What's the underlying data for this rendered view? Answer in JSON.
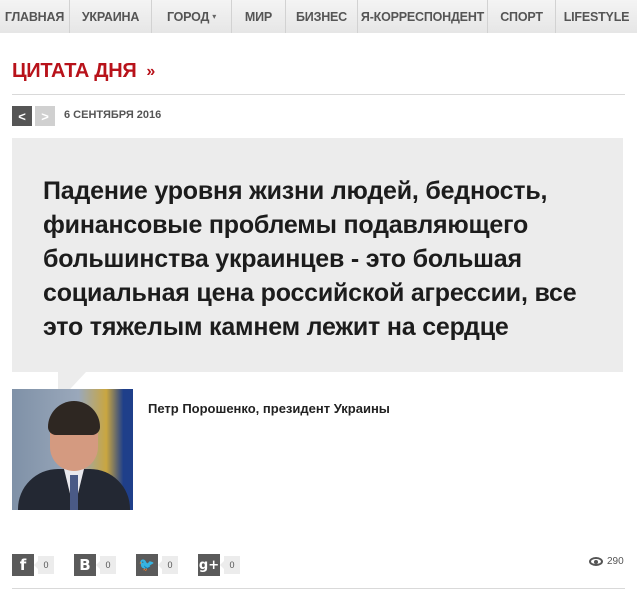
{
  "nav": {
    "items": [
      {
        "label": "ГЛАВНАЯ"
      },
      {
        "label": "УКРАИНА"
      },
      {
        "label": "ГОРОД",
        "caret": "▾"
      },
      {
        "label": "МИР"
      },
      {
        "label": "БИЗНЕС"
      },
      {
        "label": "Я-КОРРЕСПОНДЕНТ"
      },
      {
        "label": "СПОРТ"
      },
      {
        "label": "LIFESTYLE"
      }
    ]
  },
  "section": {
    "title": "ЦИТАТА ДНЯ",
    "arrow": "»"
  },
  "pager": {
    "prev": "<",
    "next": ">"
  },
  "date": "6 СЕНТЯБРЯ 2016",
  "quote": {
    "text": "Падение уровня жизни людей, бедность, финансовые проблемы подавляющего большинства украинцев - это большая социальная цена российской агрессии, все это тяжелым камнем лежит на сердце",
    "author": "Петр Порошенко, президент Украины"
  },
  "share": [
    {
      "network": "facebook",
      "glyph": "f",
      "count": "0"
    },
    {
      "network": "vkontakte",
      "glyph": "B",
      "count": "0"
    },
    {
      "network": "twitter",
      "glyph": "🐦",
      "count": "0"
    },
    {
      "network": "google-plus",
      "glyph": "g+",
      "count": "0"
    }
  ],
  "views": "290",
  "colors": {
    "accent": "#b8121a",
    "quote_bg": "#ececec",
    "icon_bg": "#5a5a5a"
  }
}
